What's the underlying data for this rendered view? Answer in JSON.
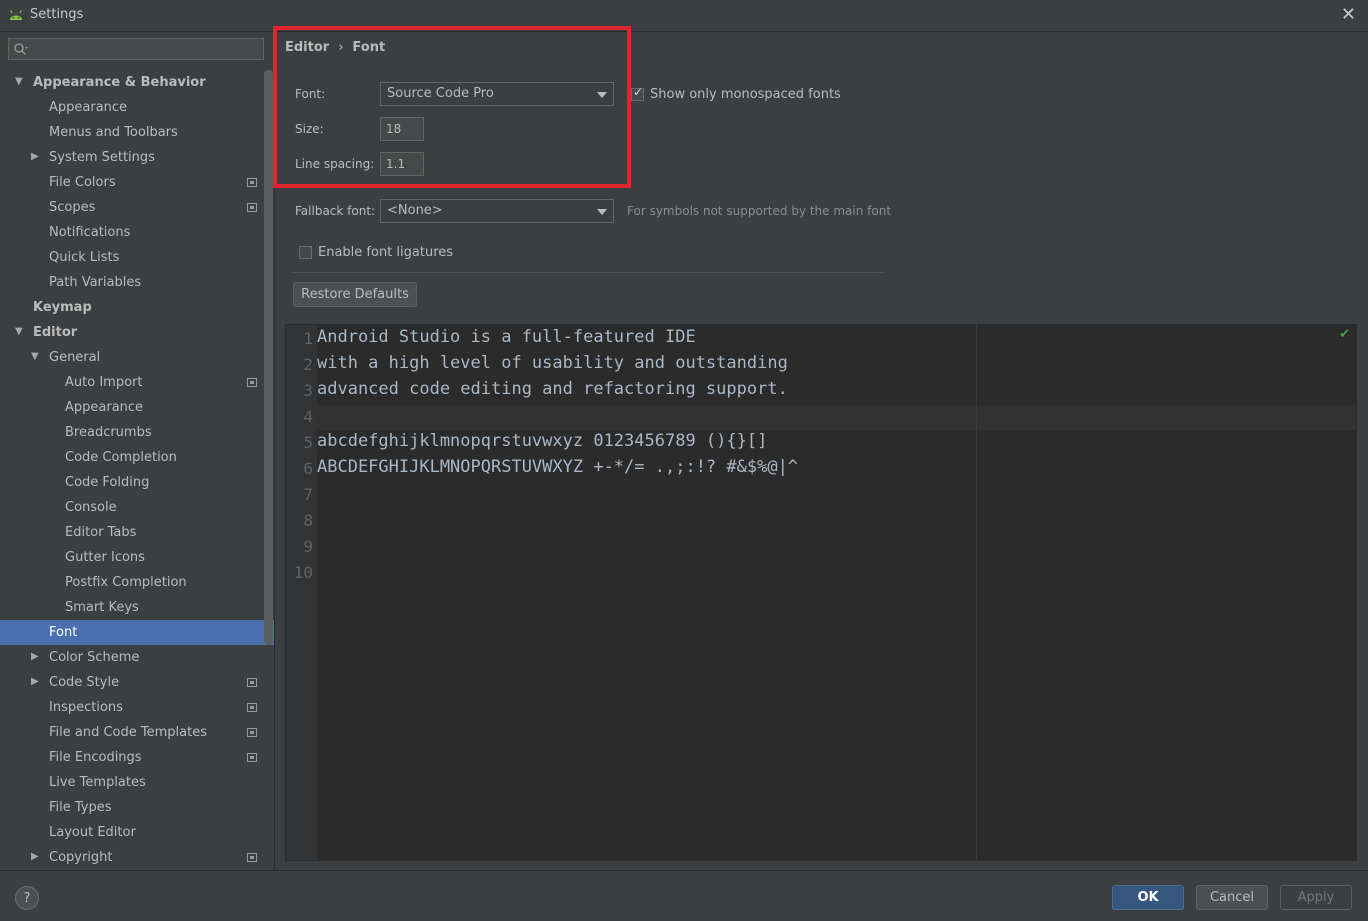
{
  "window": {
    "title": "Settings",
    "close_label": "✕"
  },
  "search": {
    "placeholder": "",
    "value": ""
  },
  "sidebar": {
    "items": [
      {
        "label": "Appearance & Behavior",
        "bold": true,
        "expanded": true,
        "has_arrow": true,
        "level": 0
      },
      {
        "label": "Appearance",
        "level": 1
      },
      {
        "label": "Menus and Toolbars",
        "level": 1
      },
      {
        "label": "System Settings",
        "level": 1,
        "has_arrow": true,
        "expanded": false
      },
      {
        "label": "File Colors",
        "level": 1,
        "project_icon": true
      },
      {
        "label": "Scopes",
        "level": 1,
        "project_icon": true
      },
      {
        "label": "Notifications",
        "level": 1
      },
      {
        "label": "Quick Lists",
        "level": 1
      },
      {
        "label": "Path Variables",
        "level": 1
      },
      {
        "label": "Keymap",
        "bold": true,
        "level": 0
      },
      {
        "label": "Editor",
        "bold": true,
        "expanded": true,
        "has_arrow": true,
        "level": 0
      },
      {
        "label": "General",
        "level": 1,
        "has_arrow": true,
        "expanded": true
      },
      {
        "label": "Auto Import",
        "level": 2,
        "project_icon": true
      },
      {
        "label": "Appearance",
        "level": 2
      },
      {
        "label": "Breadcrumbs",
        "level": 2
      },
      {
        "label": "Code Completion",
        "level": 2
      },
      {
        "label": "Code Folding",
        "level": 2
      },
      {
        "label": "Console",
        "level": 2
      },
      {
        "label": "Editor Tabs",
        "level": 2
      },
      {
        "label": "Gutter Icons",
        "level": 2
      },
      {
        "label": "Postfix Completion",
        "level": 2
      },
      {
        "label": "Smart Keys",
        "level": 2
      },
      {
        "label": "Font",
        "level": 1,
        "selected": true
      },
      {
        "label": "Color Scheme",
        "level": 1,
        "has_arrow": true,
        "expanded": false
      },
      {
        "label": "Code Style",
        "level": 1,
        "has_arrow": true,
        "expanded": false,
        "project_icon": true
      },
      {
        "label": "Inspections",
        "level": 1,
        "project_icon": true
      },
      {
        "label": "File and Code Templates",
        "level": 1,
        "project_icon": true
      },
      {
        "label": "File Encodings",
        "level": 1,
        "project_icon": true
      },
      {
        "label": "Live Templates",
        "level": 1
      },
      {
        "label": "File Types",
        "level": 1
      },
      {
        "label": "Layout Editor",
        "level": 1
      },
      {
        "label": "Copyright",
        "level": 1,
        "has_arrow": true,
        "expanded": false,
        "project_icon": true
      }
    ]
  },
  "breadcrumb": {
    "parent": "Editor",
    "separator": "›",
    "current": "Font"
  },
  "font_settings": {
    "font_label": "Font:",
    "font_value": "Source Code Pro",
    "monospaced_label": "Show only monospaced fonts",
    "monospaced_checked": true,
    "size_label": "Size:",
    "size_value": "18",
    "line_spacing_label": "Line spacing:",
    "line_spacing_value": "1.1",
    "fallback_label": "Fallback font:",
    "fallback_value": "<None>",
    "fallback_hint": "For symbols not supported by the main font",
    "ligatures_label": "Enable font ligatures",
    "ligatures_checked": false,
    "restore_label": "Restore Defaults"
  },
  "preview": {
    "line_numbers": [
      "1",
      "2",
      "3",
      "4",
      "5",
      "6",
      "7",
      "8",
      "9",
      "10"
    ],
    "lines": [
      "Android Studio is a full-featured IDE",
      "with a high level of usability and outstanding",
      "advanced code editing and refactoring support.",
      "",
      "abcdefghijklmnopqrstuvwxyz 0123456789 (){}[]",
      "ABCDEFGHIJKLMNOPQRSTUVWXYZ +-*/= .,;:!? #&$%@|^"
    ],
    "status_icon": "✔"
  },
  "footer": {
    "help_label": "?",
    "ok_label": "OK",
    "cancel_label": "Cancel",
    "apply_label": "Apply"
  },
  "colors": {
    "background": "#3c3f41",
    "editor_bg": "#2b2b2b",
    "selection": "#4b6eaf",
    "highlight_border": "#e0252e",
    "ok_button": "#365880"
  }
}
